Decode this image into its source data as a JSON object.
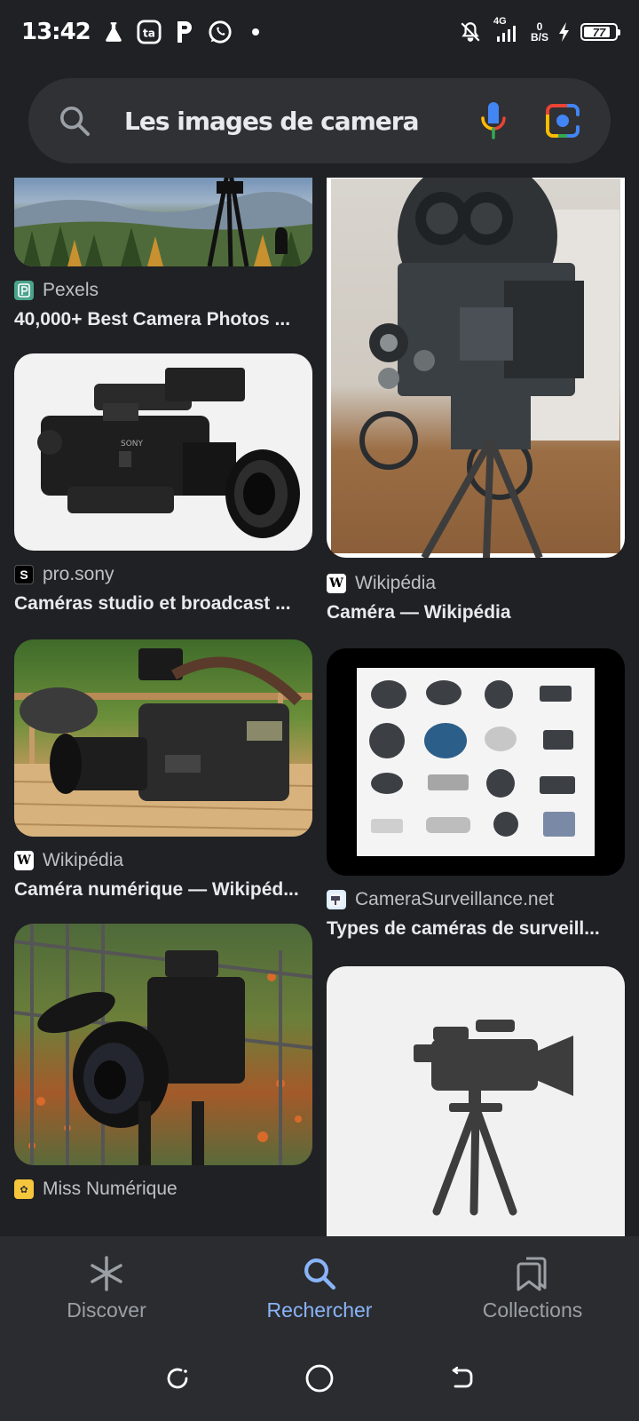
{
  "status_bar": {
    "time": "13:42",
    "network": "4G",
    "speed_value": "0",
    "speed_unit": "B/S",
    "battery": "77"
  },
  "search": {
    "query": "Les images de camera"
  },
  "results": {
    "left": [
      {
        "source": "Pexels",
        "title": "40,000+ Best Camera Photos ...",
        "favicon_color": "#4aa38c",
        "favicon_letter": "P"
      },
      {
        "source": "pro.sony",
        "title": "Caméras studio et broadcast ...",
        "favicon_color": "#000000",
        "favicon_letter": "S"
      },
      {
        "source": "Wikipédia",
        "title": "Caméra numérique — Wikipéd...",
        "favicon_color": "#ffffff",
        "favicon_letter": "W"
      },
      {
        "source": "Miss Numérique",
        "title": "",
        "favicon_color": "#f5c63c",
        "favicon_letter": ""
      }
    ],
    "right": [
      {
        "source": "Wikipédia",
        "title": "Caméra — Wikipédia",
        "favicon_color": "#ffffff",
        "favicon_letter": "W"
      },
      {
        "source": "CameraSurveillance.net",
        "title": "Types de caméras de surveill...",
        "favicon_color": "#ddeeff",
        "favicon_letter": ""
      },
      {
        "source": "",
        "title": "",
        "favicon_color": "",
        "favicon_letter": ""
      }
    ]
  },
  "bottom_nav": {
    "discover": "Discover",
    "search": "Rechercher",
    "collections": "Collections"
  },
  "colors": {
    "background": "#202124",
    "search_bar": "#303134",
    "accent": "#8ab4f8",
    "text": "#e8eaed",
    "muted": "#9aa0a6"
  }
}
